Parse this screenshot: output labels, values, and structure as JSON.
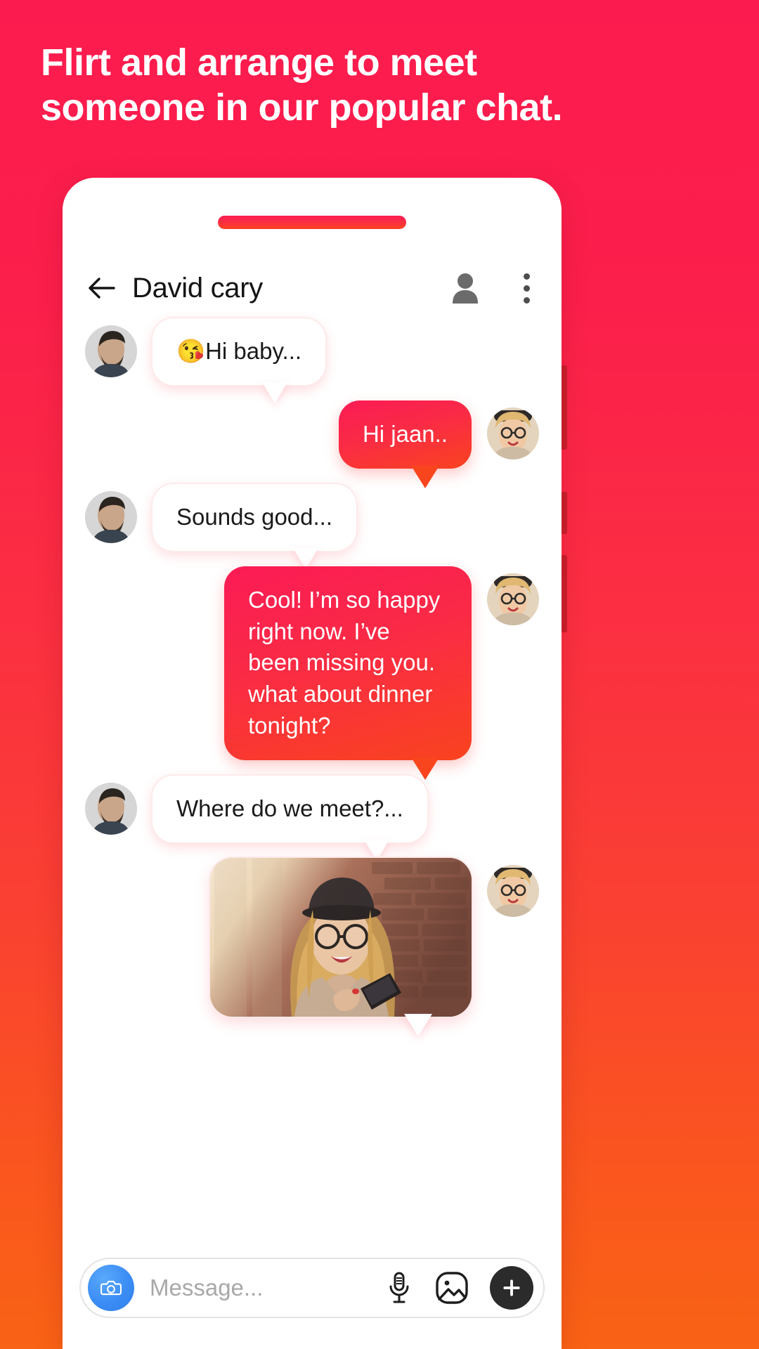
{
  "promo": {
    "line1": "Flirt and arrange to meet",
    "line2": "someone in our popular chat."
  },
  "colors": {
    "background_top": "#FC1B4E",
    "background_bottom": "#F96315",
    "sent_bubble": "#FB1B55",
    "camera_blue": "#3B8DF5",
    "plus_dark": "#2B2B2B"
  },
  "appbar": {
    "back_label": "back-arrow",
    "title": "David cary",
    "profile_label": "profile",
    "menu_label": "more-options"
  },
  "messages": [
    {
      "id": 1,
      "side": "in",
      "type": "text",
      "emoji": "😘",
      "text": "Hi baby..."
    },
    {
      "id": 2,
      "side": "out",
      "type": "text",
      "text": "Hi jaan.."
    },
    {
      "id": 3,
      "side": "in",
      "type": "text",
      "text": "Sounds good..."
    },
    {
      "id": 4,
      "side": "out",
      "type": "text",
      "text": "Cool! I’m so happy right now. I’ve been missing you. what about dinner tonight?"
    },
    {
      "id": 5,
      "side": "in",
      "type": "text",
      "text": "Where do we meet?..."
    },
    {
      "id": 6,
      "side": "out",
      "type": "image",
      "alt": "woman-with-phone-photo"
    }
  ],
  "composer": {
    "camera_label": "camera",
    "placeholder": "Message...",
    "mic_label": "voice-message",
    "gallery_label": "gallery",
    "add_label": "add-attachment"
  }
}
